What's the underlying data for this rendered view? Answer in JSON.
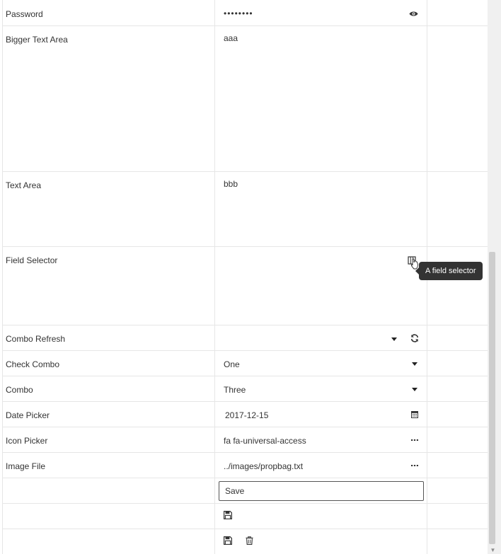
{
  "rows": [
    {
      "label": "Password",
      "value": "••••••••",
      "icon": "eye-icon"
    },
    {
      "label": "Bigger Text Area",
      "value": "aaa"
    },
    {
      "label": "Text Area",
      "value": "bbb"
    },
    {
      "label": "Field Selector",
      "value": "",
      "icon": "field-selector-icon",
      "tooltip": "A field selector"
    },
    {
      "label": "Combo Refresh",
      "value": "",
      "icons": [
        "chevron-down-icon",
        "refresh-icon"
      ]
    },
    {
      "label": "Check Combo",
      "value": "One",
      "icon": "chevron-down-icon"
    },
    {
      "label": "Combo",
      "value": "Three",
      "icon": "chevron-down-icon"
    },
    {
      "label": "Date Picker",
      "value": "2017-12-15",
      "icon": "calendar-icon"
    },
    {
      "label": "Icon Picker",
      "value": "fa fa-universal-access",
      "icon": "ellipsis-icon"
    },
    {
      "label": "Image File",
      "value": "../images/propbag.txt",
      "icon": "ellipsis-icon"
    },
    {
      "label": "",
      "input_value": "Save"
    },
    {
      "label": "",
      "icons": [
        "save-icon"
      ]
    },
    {
      "label": "",
      "icons": [
        "save-icon",
        "trash-icon"
      ]
    }
  ]
}
